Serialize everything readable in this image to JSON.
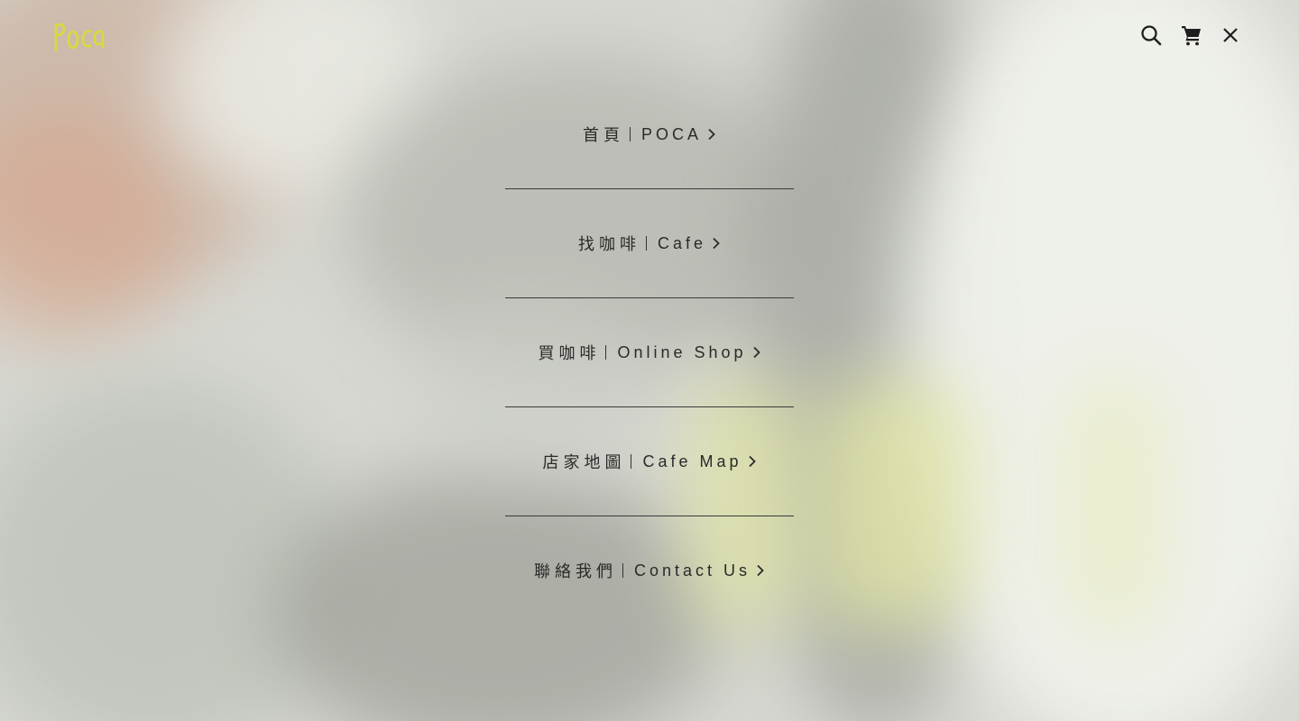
{
  "brand": {
    "logo_text": "POCA",
    "logo_color": "#d6dc3c"
  },
  "header_icons": [
    "search-icon",
    "cart-icon",
    "close-icon"
  ],
  "colors": {
    "text": "#2a2a2a",
    "divider": "#3a3a3a",
    "accent": "#d6dc3c"
  },
  "menu": {
    "items": [
      {
        "zh": "首頁",
        "en": "POCA"
      },
      {
        "zh": "找咖啡",
        "en": "Cafe"
      },
      {
        "zh": "買咖啡",
        "en": "Online Shop"
      },
      {
        "zh": "店家地圖",
        "en": "Cafe Map"
      },
      {
        "zh": "聯絡我們",
        "en": "Contact Us"
      }
    ]
  }
}
